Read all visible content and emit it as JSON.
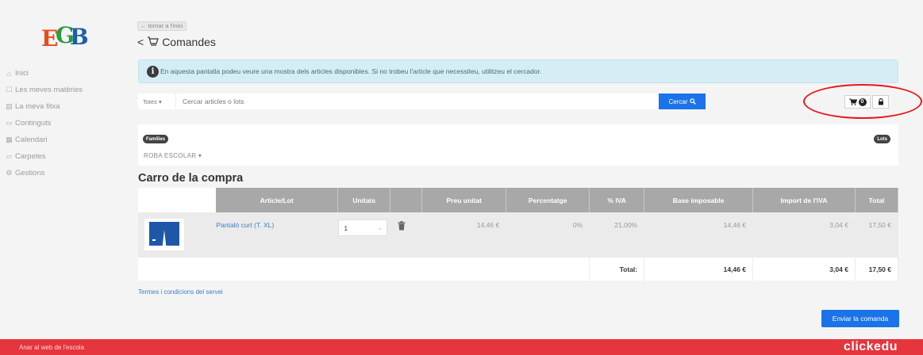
{
  "sidebar": {
    "items": [
      {
        "label": "Inici",
        "icon": "home-icon"
      },
      {
        "label": "Les meves matèries",
        "icon": "book-icon"
      },
      {
        "label": "La meva fitxa",
        "icon": "id-card-icon"
      },
      {
        "label": "Continguts",
        "icon": "folder-icon"
      },
      {
        "label": "Calendari",
        "icon": "calendar-icon"
      },
      {
        "label": "Carpetes",
        "icon": "folder-open-icon"
      },
      {
        "label": "Gestions",
        "icon": "gears-icon"
      }
    ]
  },
  "header": {
    "back_link": "← tornar a l'inici",
    "title": "Comandes"
  },
  "info": {
    "text": "En aquesta pantalla podeu veure una mostra dels articles disponibles. Si no trobeu l'article que necessiteu, utilitzeu el cercador."
  },
  "search": {
    "scope": "Totes",
    "placeholder": "Cercar articles o lots",
    "button_label": "Cercar"
  },
  "cart_badge": {
    "count": "0"
  },
  "filters": {
    "families_pill": "Famílies",
    "lots_pill": "Lots",
    "selected_family": "ROBA ESCOLAR"
  },
  "cart": {
    "title": "Carro de la compra",
    "columns": [
      "Article/Lot",
      "Unitats",
      "Preu unitat",
      "Percentatge",
      "% IVA",
      "Base imposable",
      "Import de l'IVA",
      "Total"
    ],
    "rows": [
      {
        "article": "Pantaló curt (T. XL)",
        "units": "1",
        "unit_price": "14,46 €",
        "percentage": "0%",
        "vat_percent": "21,00%",
        "taxable_base": "14,46 €",
        "vat_amount": "3,04 €",
        "total": "17,50 €"
      }
    ],
    "totals": {
      "label": "Total:",
      "taxable_base": "14,46 €",
      "vat_amount": "3,04 €",
      "total": "17,50 €"
    }
  },
  "terms_link": "Termes i condicions del servei",
  "send_button": "Enviar la comanda",
  "footer": {
    "link": "Anar al web de l'escola",
    "brand": "clickedu"
  },
  "colors": {
    "accent": "#1a73e8",
    "footer": "#e5353d",
    "highlight": "#e8161b"
  }
}
